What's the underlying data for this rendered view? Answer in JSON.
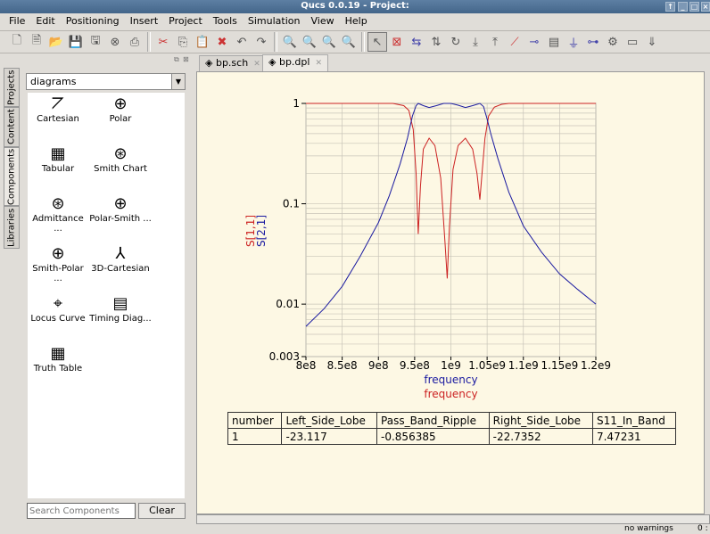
{
  "window": {
    "title": "Qucs 0.0.19 - Project:",
    "controls": [
      "↑",
      "_",
      "□",
      "×"
    ]
  },
  "menu": [
    "File",
    "Edit",
    "Positioning",
    "Insert",
    "Project",
    "Tools",
    "Simulation",
    "View",
    "Help"
  ],
  "toolbar": {
    "file": [
      "new-icon",
      "new-text-icon",
      "open-icon",
      "save-icon",
      "save-all-icon",
      "close-icon",
      "print-icon"
    ],
    "edit": [
      "cut-icon",
      "copy-icon",
      "paste-icon",
      "delete-icon",
      "undo-icon",
      "redo-icon"
    ],
    "zoom": [
      "zoom-fit-icon",
      "zoom-in-icon",
      "zoom-out-icon",
      "zoom-reset-icon"
    ],
    "tools": [
      "select-icon",
      "deactivate-icon",
      "mirror-x-icon",
      "mirror-y-icon",
      "rotate-icon",
      "move-down-icon",
      "move-up-icon",
      "wire-icon",
      "label-icon",
      "equation-icon",
      "ground-icon",
      "port-icon",
      "simulate-icon",
      "view-data-icon",
      "marker-icon"
    ]
  },
  "dock": {
    "vertical_tabs": [
      "Projects",
      "Content",
      "Components",
      "Libraries"
    ],
    "active_tab": "Components",
    "category": "diagrams",
    "components": [
      {
        "label": "Cartesian",
        "icon": "cartesian-diagram-icon"
      },
      {
        "label": "Polar",
        "icon": "polar-diagram-icon"
      },
      {
        "label": "Tabular",
        "icon": "tabular-icon"
      },
      {
        "label": "Smith Chart",
        "icon": "smith-chart-icon"
      },
      {
        "label": "Admittance ...",
        "icon": "admittance-icon"
      },
      {
        "label": "Polar-Smith ...",
        "icon": "polar-smith-icon"
      },
      {
        "label": "Smith-Polar ...",
        "icon": "smith-polar-icon"
      },
      {
        "label": "3D-Cartesian",
        "icon": "3d-cartesian-icon"
      },
      {
        "label": "Locus Curve",
        "icon": "locus-curve-icon"
      },
      {
        "label": "Timing Diag...",
        "icon": "timing-diagram-icon"
      },
      {
        "label": "Truth Table",
        "icon": "truth-table-icon"
      }
    ],
    "search_placeholder": "Search Components",
    "clear_label": "Clear"
  },
  "tabs": [
    {
      "label": "bp.sch",
      "active": false
    },
    {
      "label": "bp.dpl",
      "active": true
    }
  ],
  "chart_data": {
    "type": "line",
    "xlabel": [
      "frequency",
      "frequency"
    ],
    "ylabel": [
      "S[1,1]",
      "S[2,1]"
    ],
    "yscale": "log",
    "xlim": [
      800000000.0,
      1200000000.0
    ],
    "ylim": [
      0.003,
      1
    ],
    "xticks": [
      "8e8",
      "8.5e8",
      "9e8",
      "9.5e8",
      "1e9",
      "1.05e9",
      "1.1e9",
      "1.15e9",
      "1.2e9"
    ],
    "yticks": [
      "1",
      "0.1",
      "0.01",
      "0.003"
    ],
    "grid": true,
    "series": [
      {
        "name": "S[1,1]",
        "color": "#cc2222",
        "x": [
          800000000.0,
          920000000.0,
          935000000.0,
          942000000.0,
          948000000.0,
          952000000.0,
          955000000.0,
          958000000.0,
          962000000.0,
          970000000.0,
          978000000.0,
          986000000.0,
          992000000.0,
          995000000.0,
          998000000.0,
          1003000000.0,
          1010000000.0,
          1020000000.0,
          1030000000.0,
          1036000000.0,
          1040000000.0,
          1043000000.0,
          1047000000.0,
          1052000000.0,
          1060000000.0,
          1070000000.0,
          1080000000.0,
          1200000000.0
        ],
        "y": [
          1,
          1,
          0.95,
          0.85,
          0.55,
          0.2,
          0.05,
          0.15,
          0.35,
          0.45,
          0.38,
          0.18,
          0.04,
          0.018,
          0.06,
          0.22,
          0.38,
          0.45,
          0.35,
          0.2,
          0.11,
          0.2,
          0.45,
          0.75,
          0.92,
          0.98,
          1,
          1
        ]
      },
      {
        "name": "S[2,1]",
        "color": "#1a1aa0",
        "x": [
          800000000.0,
          825000000.0,
          850000000.0,
          875000000.0,
          900000000.0,
          915000000.0,
          930000000.0,
          940000000.0,
          947000000.0,
          952000000.0,
          955000000.0,
          962000000.0,
          970000000.0,
          980000000.0,
          990000000.0,
          1000000000.0,
          1010000000.0,
          1020000000.0,
          1030000000.0,
          1040000000.0,
          1045000000.0,
          1050000000.0,
          1055000000.0,
          1065000000.0,
          1080000000.0,
          1100000000.0,
          1125000000.0,
          1150000000.0,
          1175000000.0,
          1200000000.0
        ],
        "y": [
          0.006,
          0.009,
          0.015,
          0.03,
          0.065,
          0.12,
          0.25,
          0.45,
          0.75,
          0.95,
          1.0,
          0.95,
          0.91,
          0.95,
          1.0,
          1.0,
          0.96,
          0.91,
          0.95,
          1.0,
          0.93,
          0.7,
          0.5,
          0.28,
          0.13,
          0.06,
          0.033,
          0.02,
          0.014,
          0.01
        ]
      }
    ]
  },
  "results_table": {
    "headers": [
      "number",
      "Left_Side_Lobe",
      "Pass_Band_Ripple",
      "Right_Side_Lobe",
      "S11_In_Band"
    ],
    "rows": [
      [
        "1",
        "-23.117",
        "-0.856385",
        "-22.7352",
        "7.47231"
      ]
    ]
  },
  "status": {
    "warnings": "no warnings",
    "position": "0 :"
  }
}
